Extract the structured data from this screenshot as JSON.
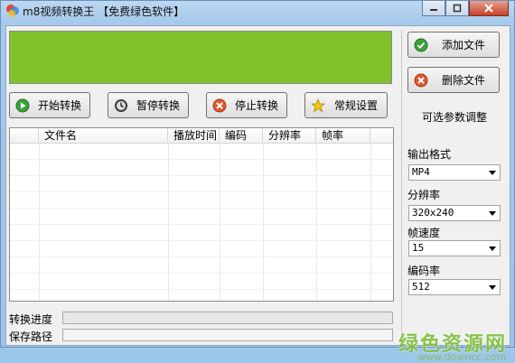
{
  "window": {
    "title": "m8视频转换王 【免费绿色软件】"
  },
  "toolbar": {
    "start": "开始转换",
    "pause": "暂停转换",
    "stop": "停止转换",
    "settings": "常规设置"
  },
  "side": {
    "add": "添加文件",
    "remove": "删除文件",
    "params_title": "可选参数调整",
    "format_label": "输出格式",
    "format_value": "MP4",
    "resolution_label": "分辨率",
    "resolution_value": "320x240",
    "fps_label": "帧速度",
    "fps_value": "15",
    "bitrate_label": "编码率",
    "bitrate_value": "512"
  },
  "table": {
    "columns": [
      "文件名",
      "播放时间",
      "编码",
      "分辨率",
      "帧率"
    ],
    "rows": []
  },
  "status": {
    "progress_label": "转换进度",
    "progress": 0,
    "path_label": "保存路径",
    "path_value": ""
  },
  "watermark": {
    "cn": "绿色资源网",
    "url": "www.downcc.com"
  },
  "colors": {
    "preview": "#7fc22b",
    "accent_green": "#7fbf3a"
  }
}
